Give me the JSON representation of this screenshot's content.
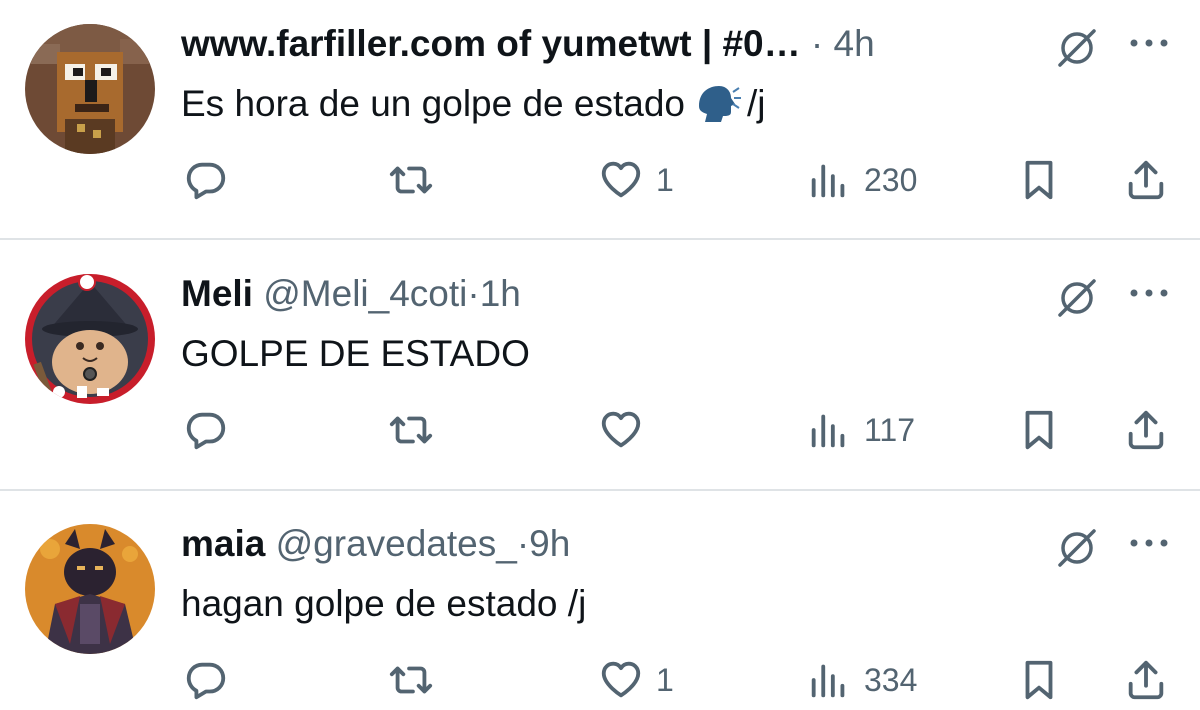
{
  "tweets": [
    {
      "name": "www.farfiller.com of yumetwt | #0…",
      "handle": "",
      "time": "4h",
      "text": "Es hora de un golpe de estado",
      "text_suffix": "/j",
      "has_emoji": true,
      "emoji": "speaking-head",
      "replies": "",
      "retweets": "",
      "likes": "1",
      "views": "230",
      "avatar": "pixel-character-brown"
    },
    {
      "name": "Meli",
      "handle": "@Meli_4coti",
      "time": "1h",
      "text": "GOLPE DE ESTADO",
      "text_suffix": "",
      "has_emoji": false,
      "replies": "",
      "retweets": "",
      "likes": "",
      "views": "117",
      "avatar": "cat-wizard-red-ring"
    },
    {
      "name": "maia",
      "handle": "@gravedates_",
      "time": "9h",
      "text": "hagan golpe de estado /j",
      "text_suffix": "",
      "has_emoji": false,
      "replies": "",
      "retweets": "",
      "likes": "1",
      "views": "334",
      "avatar": "dark-figure-orange"
    }
  ],
  "separator": "·",
  "icons": {
    "reply": "reply-icon",
    "retweet": "retweet-icon",
    "like": "heart-icon",
    "views": "views-icon",
    "bookmark": "bookmark-icon",
    "share": "share-icon",
    "grok": "grok-icon",
    "more": "more-icon"
  },
  "colors": {
    "text": "#0f1419",
    "secondary": "#536471",
    "divider": "#dfe3e6"
  }
}
